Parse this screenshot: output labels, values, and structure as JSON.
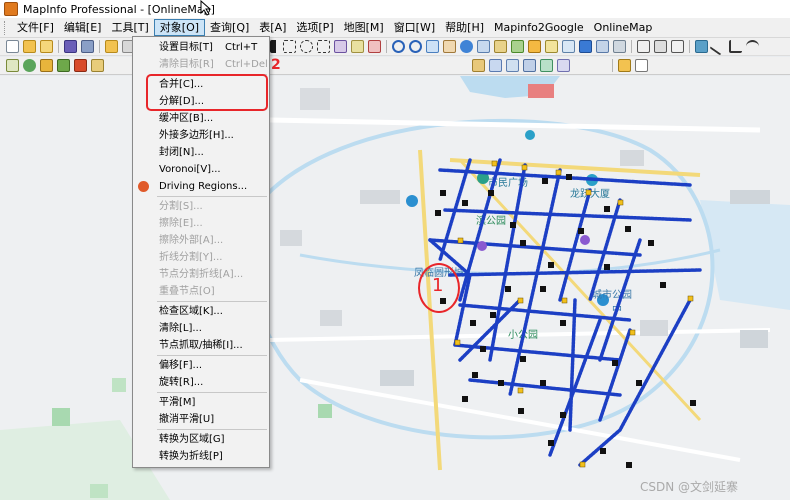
{
  "window": {
    "title": "MapInfo Professional - [OnlineMap]"
  },
  "menubar": {
    "items": [
      "文件[F]",
      "编辑[E]",
      "工具[T]",
      "对象[O]",
      "查询[Q]",
      "表[A]",
      "选项[P]",
      "地图[M]",
      "窗口[W]",
      "帮助[H]",
      "Mapinfo2Google",
      "OnlineMap"
    ],
    "active_index": 3
  },
  "object_menu": {
    "items": [
      {
        "label": "设置目标[T]",
        "shortcut": "Ctrl+T",
        "enabled": true
      },
      {
        "label": "清除目标[R]",
        "shortcut": "Ctrl+Del",
        "enabled": false
      },
      {
        "label": "合并[C]...",
        "shortcut": "",
        "enabled": true
      },
      {
        "label": "分解[D]...",
        "shortcut": "",
        "enabled": true
      },
      {
        "label": "缓冲区[B]...",
        "shortcut": "",
        "enabled": true
      },
      {
        "label": "外接多边形[H]...",
        "shortcut": "",
        "enabled": true
      },
      {
        "label": "封闭[N]...",
        "shortcut": "",
        "enabled": true
      },
      {
        "label": "Voronoi[V]...",
        "shortcut": "",
        "enabled": true
      },
      {
        "label": "Driving Regions...",
        "shortcut": "",
        "enabled": true
      },
      {
        "label": "分割[S]...",
        "shortcut": "",
        "enabled": false
      },
      {
        "label": "擦除[E]...",
        "shortcut": "",
        "enabled": false
      },
      {
        "label": "擦除外部[A]...",
        "shortcut": "",
        "enabled": false
      },
      {
        "label": "折线分割[Y]...",
        "shortcut": "",
        "enabled": false
      },
      {
        "label": "节点分割折线[A]...",
        "shortcut": "",
        "enabled": false
      },
      {
        "label": "重叠节点[O]",
        "shortcut": "",
        "enabled": false
      },
      {
        "label": "检查区域[K]...",
        "shortcut": "",
        "enabled": true
      },
      {
        "label": "清除[L]...",
        "shortcut": "",
        "enabled": true
      },
      {
        "label": "节点抓取/抽稀[I]...",
        "shortcut": "",
        "enabled": true
      },
      {
        "label": "偏移[F]...",
        "shortcut": "",
        "enabled": true
      },
      {
        "label": "旋转[R]...",
        "shortcut": "",
        "enabled": true
      },
      {
        "label": "平滑[M]",
        "shortcut": "",
        "enabled": true
      },
      {
        "label": "撤消平滑[U]",
        "shortcut": "",
        "enabled": true
      },
      {
        "label": "转换为区域[G]",
        "shortcut": "",
        "enabled": true
      },
      {
        "label": "转换为折线[P]",
        "shortcut": "",
        "enabled": true
      }
    ]
  },
  "annotations": {
    "label_2": "2",
    "label_1": "1"
  },
  "map": {
    "labels": {
      "shimin_square": "市民广场",
      "longyue_building": "龙跃大厦",
      "binhu_park": "滨公园",
      "city_park": "城市公园",
      "fenghe_sq": "凤临圆形城",
      "middle_school": "中",
      "xiaoshi_park": "小公园"
    },
    "watermark": "CSDN @文剑延寨"
  },
  "colors": {
    "accent_red": "#e8262a",
    "route_blue": "#1c3fc4",
    "road_yellow": "#f3d97a",
    "water_blue": "#bcdcf0",
    "park_green": "#bfe3c4"
  }
}
